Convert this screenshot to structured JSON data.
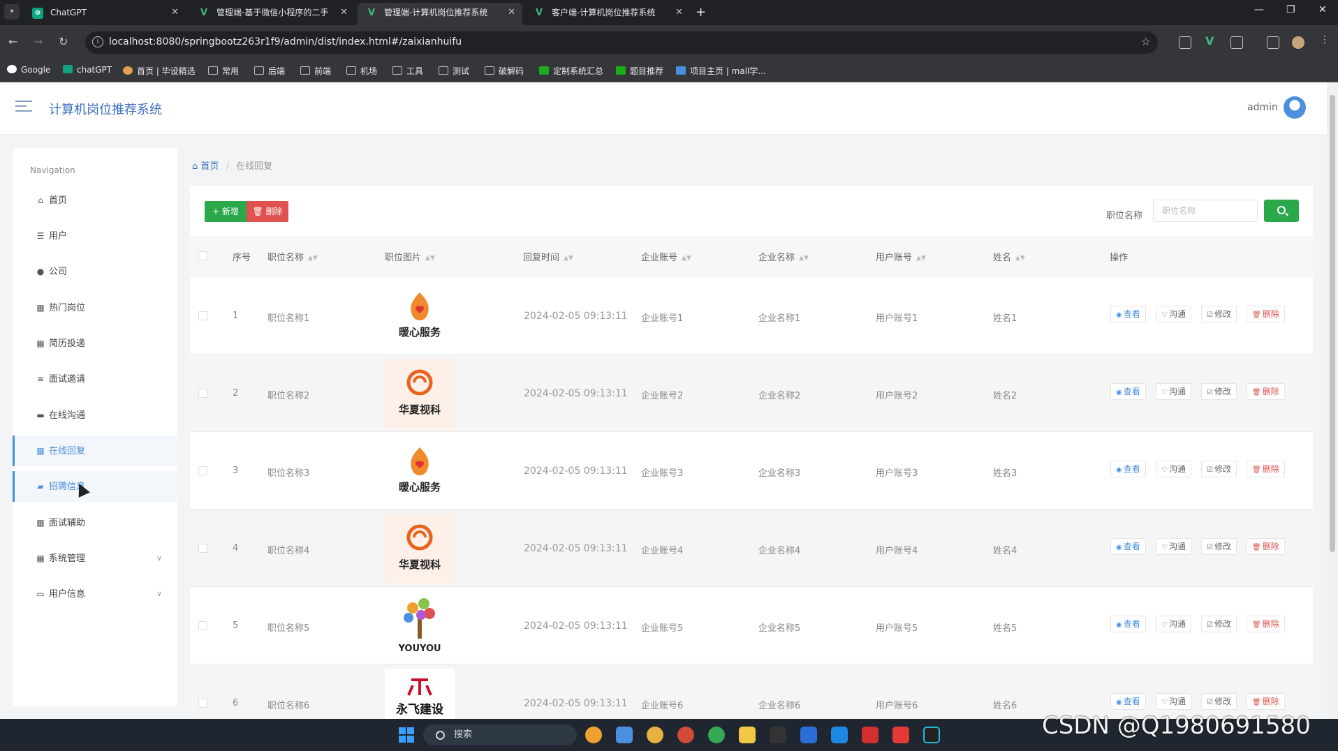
{
  "browser": {
    "tabs": [
      {
        "title": "ChatGPT",
        "icon": "chatgpt-icon",
        "active": false
      },
      {
        "title": "管理端-基于微信小程序的二手",
        "icon": "vue-icon",
        "active": false
      },
      {
        "title": "管理端-计算机岗位推荐系统",
        "icon": "vue-icon",
        "active": true
      },
      {
        "title": "客户端-计算机岗位推荐系统",
        "icon": "vue-icon",
        "active": false
      }
    ],
    "url": "localhost:8080/springbootz263r1f9/admin/dist/index.html#/zaixianhuifu",
    "bookmarks": [
      "Google",
      "chatGPT",
      "首页 | 毕设精选",
      "常用",
      "后端",
      "前端",
      "机场",
      "工具",
      "测试",
      "破解码",
      "定制系统汇总",
      "题目推荐",
      "项目主页 | mall学..."
    ]
  },
  "app": {
    "title": "计算机岗位推荐系统",
    "user": "admin"
  },
  "sidebar": {
    "caption": "Navigation",
    "items": [
      {
        "label": "首页",
        "icon": "home-icon"
      },
      {
        "label": "用户",
        "icon": "sliders-icon"
      },
      {
        "label": "公司",
        "icon": "user-icon"
      },
      {
        "label": "热门岗位",
        "icon": "grid-icon"
      },
      {
        "label": "简历投递",
        "icon": "grid-icon"
      },
      {
        "label": "面试邀请",
        "icon": "list-icon"
      },
      {
        "label": "在线沟通",
        "icon": "chat-icon"
      },
      {
        "label": "在线回复",
        "icon": "grid-icon",
        "active": true
      },
      {
        "label": "招聘信息",
        "icon": "ticket-icon"
      },
      {
        "label": "面试辅助",
        "icon": "grid-icon"
      },
      {
        "label": "系统管理",
        "icon": "grid-icon",
        "expandable": true
      },
      {
        "label": "用户信息",
        "icon": "card-icon",
        "expandable": true
      }
    ]
  },
  "breadcrumb": {
    "home": "首页",
    "separator": "/",
    "current": "在线回复"
  },
  "toolbar": {
    "add_label": "新增",
    "delete_label": "删除",
    "search_label": "职位名称",
    "search_placeholder": "职位名称"
  },
  "table": {
    "columns": [
      "序号",
      "职位名称",
      "职位图片",
      "回复时间",
      "企业账号",
      "企业名称",
      "用户账号",
      "姓名",
      "操作"
    ],
    "rows": [
      {
        "no": "1",
        "job": "职位名称1",
        "logo": "暖心服务",
        "time": "2024-02-05 09:13:11",
        "company_account": "企业账号1",
        "company_name": "企业名称1",
        "user_account": "用户账号1",
        "name": "姓名1"
      },
      {
        "no": "2",
        "job": "职位名称2",
        "logo": "华夏视科",
        "time": "2024-02-05 09:13:11",
        "company_account": "企业账号2",
        "company_name": "企业名称2",
        "user_account": "用户账号2",
        "name": "姓名2"
      },
      {
        "no": "3",
        "job": "职位名称3",
        "logo": "暖心服务",
        "time": "2024-02-05 09:13:11",
        "company_account": "企业账号3",
        "company_name": "企业名称3",
        "user_account": "用户账号3",
        "name": "姓名3"
      },
      {
        "no": "4",
        "job": "职位名称4",
        "logo": "华夏视科",
        "time": "2024-02-05 09:13:11",
        "company_account": "企业账号4",
        "company_name": "企业名称4",
        "user_account": "用户账号4",
        "name": "姓名4"
      },
      {
        "no": "5",
        "job": "职位名称5",
        "logo": "YOUYOU",
        "time": "2024-02-05 09:13:11",
        "company_account": "企业账号5",
        "company_name": "企业名称5",
        "user_account": "用户账号5",
        "name": "姓名5"
      },
      {
        "no": "6",
        "job": "职位名称6",
        "logo": "永飞建设",
        "time": "2024-02-05 09:13:11",
        "company_account": "企业账号6",
        "company_name": "企业名称6",
        "user_account": "用户账号6",
        "name": "姓名6"
      }
    ],
    "actions": {
      "view": "查看",
      "chat": "沟通",
      "edit": "修改",
      "delete": "删除"
    }
  },
  "taskbar": {
    "search_placeholder": "搜索"
  },
  "watermark": "CSDN @Q1980691580",
  "colors": {
    "primary": "#3a6fbf",
    "accent": "#4a8fe0",
    "success": "#2aa84a",
    "danger": "#e0524f"
  }
}
